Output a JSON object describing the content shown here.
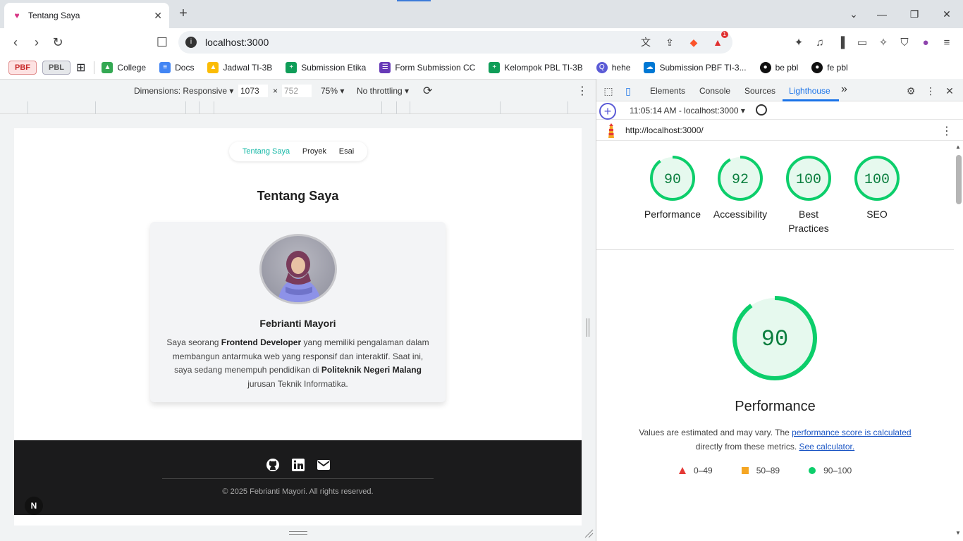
{
  "browser": {
    "tab_title": "Tentang Saya",
    "tab_close": "✕",
    "new_tab": "+",
    "url": "localhost:3000",
    "bat_badge": "1"
  },
  "bookmarks": {
    "pbf": "PBF",
    "pbl": "PBL",
    "items": [
      "College",
      "Docs",
      "Jadwal TI-3B",
      "Submission Etika",
      "Form Submission CC",
      "Kelompok PBL TI-3B",
      "hehe",
      "Submission PBF TI-3...",
      "be pbl",
      "fe pbl"
    ]
  },
  "device_toolbar": {
    "dimensions": "Dimensions: Responsive",
    "width": "1073",
    "times": "×",
    "height": "752",
    "zoom": "75%",
    "throttling": "No throttling"
  },
  "site": {
    "nav": [
      "Tentang Saya",
      "Proyek",
      "Esai"
    ],
    "heading": "Tentang Saya",
    "name": "Febrianti Mayori",
    "bio_1": "Saya seorang ",
    "bio_b1": "Frontend Developer",
    "bio_2": " yang memiliki pengalaman dalam membangun antarmuka web yang responsif dan interaktif. Saat ini, saya sedang menempuh pendidikan di ",
    "bio_b2": "Politeknik Negeri Malang",
    "bio_3": " jurusan Teknik Informatika.",
    "copyright": "© 2025 Febrianti Mayori. All rights reserved.",
    "next_badge": "N"
  },
  "devtools": {
    "tabs": [
      "Elements",
      "Console",
      "Sources",
      "Lighthouse"
    ],
    "active_tab": "Lighthouse",
    "more_tabs": "»",
    "report_time": "11:05:14 AM - localhost:3000",
    "report_url": "http://localhost:3000/",
    "scores": [
      {
        "value": 90,
        "label": "Performance"
      },
      {
        "value": 92,
        "label": "Accessibility"
      },
      {
        "value": 100,
        "label": "Best Practices"
      },
      {
        "value": 100,
        "label": "SEO"
      }
    ],
    "big_score": 90,
    "big_title": "Performance",
    "note_1": "Values are estimated and may vary. The ",
    "note_link1": "performance score is calculated",
    "note_2": " directly from these metrics. ",
    "note_link2": "See calculator.",
    "legend": [
      {
        "range": "0–49",
        "color": "#e53935"
      },
      {
        "range": "50–89",
        "color": "#f5a623"
      },
      {
        "range": "90–100",
        "color": "#0cce6b"
      }
    ],
    "pass_color": "#0cce6b",
    "pass_bg": "#e6f9ee",
    "pass_text": "#0a7e3e"
  }
}
